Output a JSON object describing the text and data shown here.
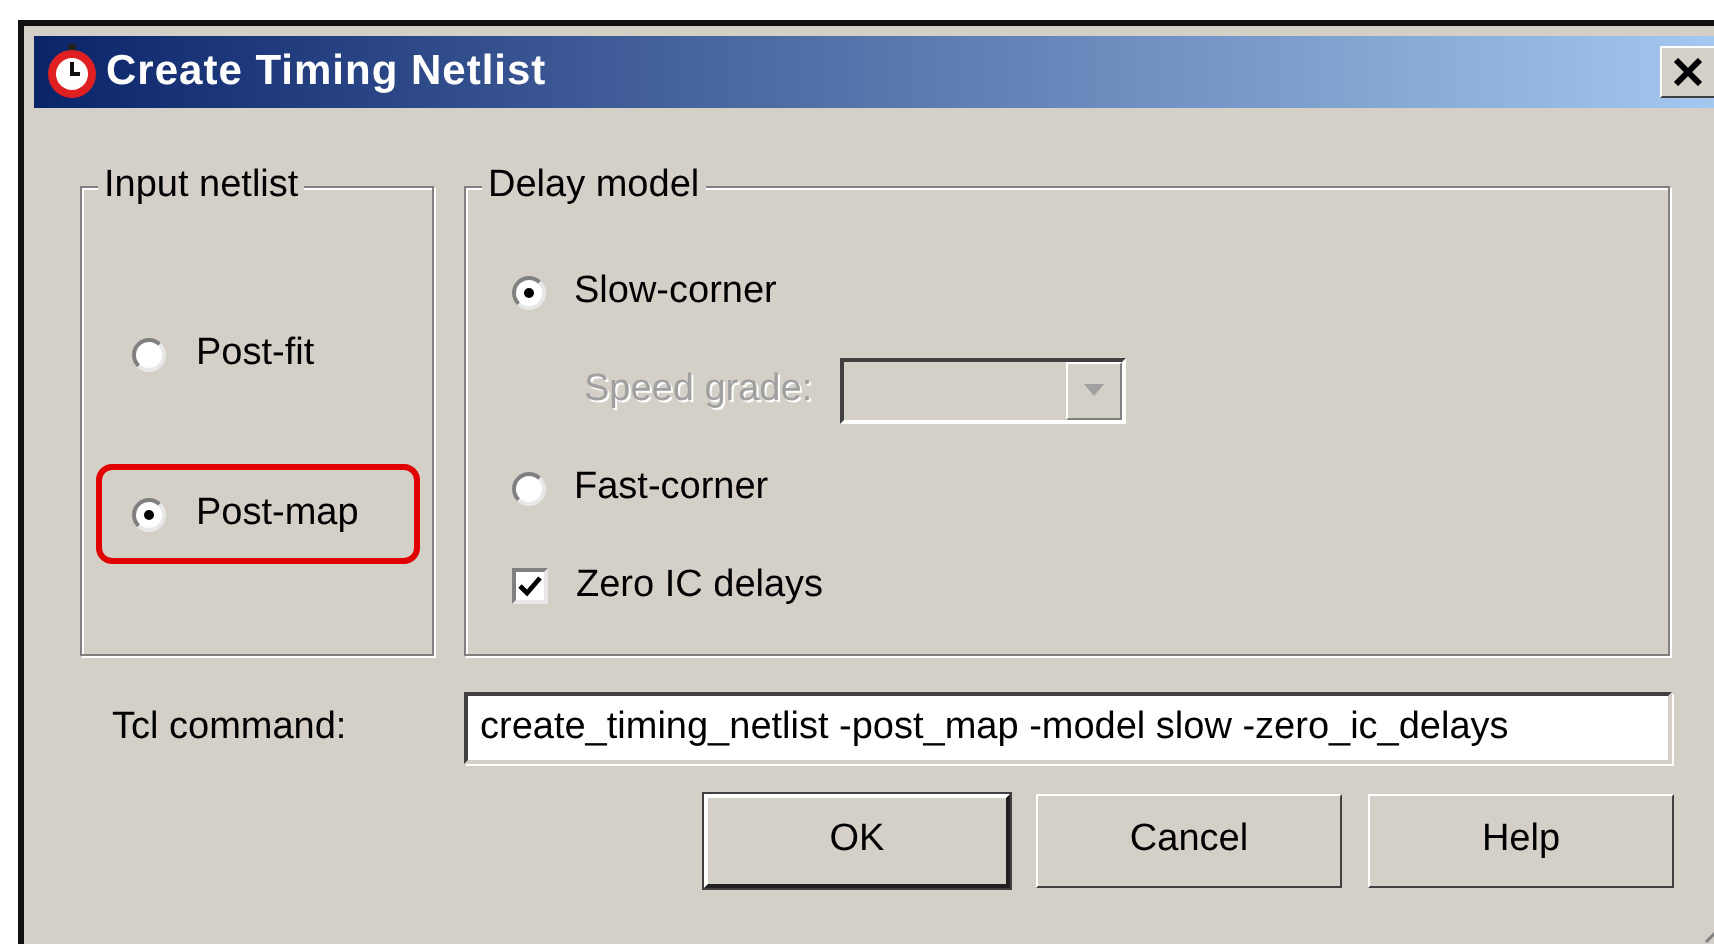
{
  "window": {
    "title": "Create Timing Netlist"
  },
  "input_netlist": {
    "label": "Input netlist",
    "options": [
      {
        "label": "Post-fit",
        "selected": false,
        "highlighted": false
      },
      {
        "label": "Post-map",
        "selected": true,
        "highlighted": true
      }
    ]
  },
  "delay_model": {
    "label": "Delay model",
    "items": [
      {
        "kind": "radio",
        "label": "Slow-corner",
        "selected": true
      },
      {
        "kind": "combo",
        "label": "Speed grade:",
        "disabled": true
      },
      {
        "kind": "radio",
        "label": "Fast-corner",
        "selected": false
      },
      {
        "kind": "checkbox",
        "label": "Zero IC delays",
        "checked": true
      }
    ]
  },
  "tcl_command": {
    "label": "Tcl command:",
    "value": "create_timing_netlist -post_map -model slow -zero_ic_delays"
  },
  "buttons": [
    {
      "label": "OK",
      "default": true
    },
    {
      "label": "Cancel",
      "default": false
    },
    {
      "label": "Help",
      "default": false
    }
  ]
}
